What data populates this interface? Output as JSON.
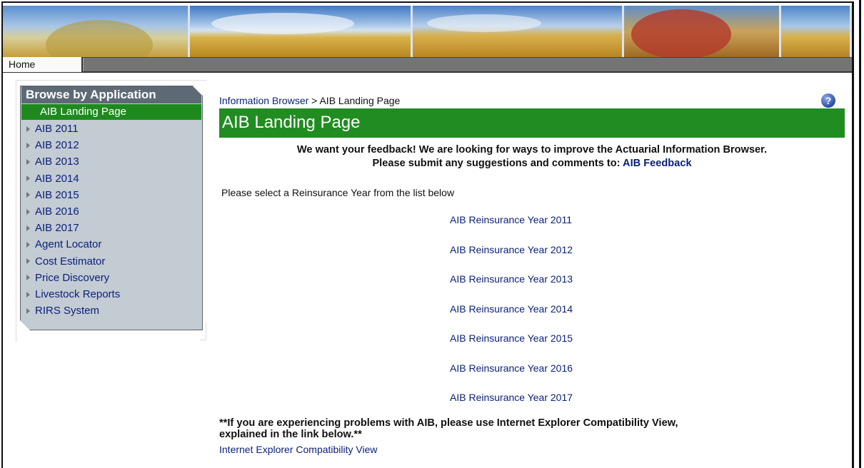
{
  "nav": {
    "home_label": "Home"
  },
  "sidebar": {
    "heading": "Browse by Application",
    "active_item": "AIB Landing Page",
    "items": [
      "AIB 2011",
      "AIB 2012",
      "AIB 2013",
      "AIB 2014",
      "AIB 2015",
      "AIB 2016",
      "AIB 2017",
      "Agent Locator",
      "Cost Estimator",
      "Price Discovery",
      "Livestock Reports",
      "RIRS System"
    ]
  },
  "breadcrumb": {
    "root": "Information Browser",
    "separator": " > ",
    "current": "AIB Landing Page"
  },
  "page": {
    "title": "AIB Landing Page",
    "feedback_line1": "We want your feedback! We are looking for ways to improve the Actuarial Information Browser.",
    "feedback_line2_prefix": "Please submit any suggestions and comments to: ",
    "feedback_link": "AIB Feedback",
    "select_prompt": "Please select a Reinsurance Year from the list below",
    "year_links": [
      "AIB Reinsurance Year 2011",
      "AIB Reinsurance Year 2012",
      "AIB Reinsurance Year 2013",
      "AIB Reinsurance Year 2014",
      "AIB Reinsurance Year 2015",
      "AIB Reinsurance Year 2016",
      "AIB Reinsurance Year 2017"
    ],
    "problem_line1": "**If you are experiencing problems with AIB, please use Internet Explorer Compatibility View,",
    "problem_line2": "explained in the link below.**",
    "ie_link": "Internet Explorer Compatibility View"
  },
  "colors": {
    "accent_green": "#218c21",
    "link_blue": "#0a1f7a",
    "sidebar_bg": "#c3cbd3",
    "sidebar_head": "#5d6a76"
  },
  "icons": {
    "help": "help-icon",
    "tree_arrow": "triangle-right-icon"
  }
}
